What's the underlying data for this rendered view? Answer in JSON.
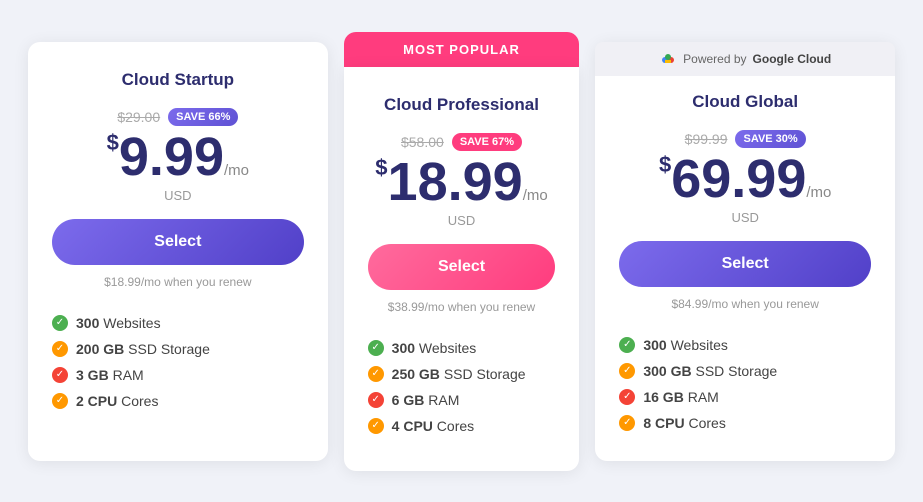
{
  "plans": [
    {
      "id": "startup",
      "title": "Cloud Startup",
      "popular": false,
      "google_cloud": false,
      "original_price": "$29.00",
      "save_badge": "SAVE 66%",
      "save_badge_style": "purple",
      "price_dollar": "$",
      "price_amount": "9.99",
      "price_period": "/mo",
      "currency": "USD",
      "select_label": "Select",
      "select_style": "purple",
      "renew_price": "$18.99/mo when you renew",
      "features": [
        {
          "icon": "green",
          "text": "300 Websites"
        },
        {
          "icon": "orange",
          "text": "200 GB SSD Storage"
        },
        {
          "icon": "red",
          "text": "3 GB RAM"
        },
        {
          "icon": "orange",
          "text": "2 CPU Cores"
        }
      ]
    },
    {
      "id": "professional",
      "title": "Cloud Professional",
      "popular": true,
      "popular_label": "MOST POPULAR",
      "google_cloud": false,
      "original_price": "$58.00",
      "save_badge": "SAVE 67%",
      "save_badge_style": "pink",
      "price_dollar": "$",
      "price_amount": "18.99",
      "price_period": "/mo",
      "currency": "USD",
      "select_label": "Select",
      "select_style": "pink",
      "renew_price": "$38.99/mo when you renew",
      "features": [
        {
          "icon": "green",
          "text": "300 Websites"
        },
        {
          "icon": "orange",
          "text": "250 GB SSD Storage"
        },
        {
          "icon": "red",
          "text": "6 GB RAM"
        },
        {
          "icon": "orange",
          "text": "4 CPU Cores"
        }
      ]
    },
    {
      "id": "global",
      "title": "Cloud Global",
      "popular": false,
      "google_cloud": true,
      "google_cloud_label": "Powered by",
      "google_cloud_text": "Google Cloud",
      "original_price": "$99.99",
      "save_badge": "SAVE 30%",
      "save_badge_style": "purple",
      "price_dollar": "$",
      "price_amount": "69.99",
      "price_period": "/mo",
      "currency": "USD",
      "select_label": "Select",
      "select_style": "purple",
      "renew_price": "$84.99/mo when you renew",
      "features": [
        {
          "icon": "green",
          "text": "300 Websites"
        },
        {
          "icon": "orange",
          "text": "300 GB SSD Storage"
        },
        {
          "icon": "red",
          "text": "16 GB RAM"
        },
        {
          "icon": "orange",
          "text": "8 CPU Cores"
        }
      ]
    }
  ]
}
